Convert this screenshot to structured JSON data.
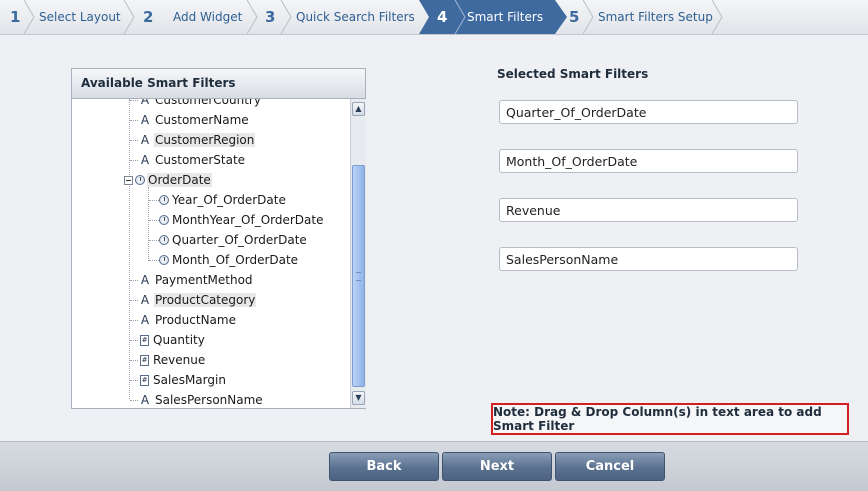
{
  "steps": [
    {
      "num": "1",
      "label": "Select Layout"
    },
    {
      "num": "2",
      "label": "Add Widget"
    },
    {
      "num": "3",
      "label": "Quick Search Filters"
    },
    {
      "num": "4",
      "label": "Smart Filters",
      "active": true
    },
    {
      "num": "5",
      "label": "Smart Filters Setup"
    }
  ],
  "available": {
    "title": "Available Smart Filters",
    "items": [
      {
        "label": "CustomerCountry",
        "icon": "text-a-icon"
      },
      {
        "label": "CustomerName",
        "icon": "text-a-icon"
      },
      {
        "label": "CustomerRegion",
        "icon": "text-a-icon"
      },
      {
        "label": "CustomerState",
        "icon": "text-a-icon"
      },
      {
        "label": "OrderDate",
        "icon": "clock-icon"
      },
      {
        "label": "Year_Of_OrderDate",
        "icon": "clock-icon"
      },
      {
        "label": "MonthYear_Of_OrderDate",
        "icon": "clock-icon"
      },
      {
        "label": "Quarter_Of_OrderDate",
        "icon": "clock-icon"
      },
      {
        "label": "Month_Of_OrderDate",
        "icon": "clock-icon"
      },
      {
        "label": "PaymentMethod",
        "icon": "text-a-icon"
      },
      {
        "label": "ProductCategory",
        "icon": "text-a-icon"
      },
      {
        "label": "ProductName",
        "icon": "text-a-icon"
      },
      {
        "label": "Quantity",
        "icon": "number-icon"
      },
      {
        "label": "Revenue",
        "icon": "number-icon"
      },
      {
        "label": "SalesMargin",
        "icon": "number-icon"
      },
      {
        "label": "SalesPersonName",
        "icon": "text-a-icon"
      }
    ]
  },
  "selected": {
    "title": "Selected Smart Filters",
    "filters": [
      "Quarter_Of_OrderDate",
      "Month_Of_OrderDate",
      "Revenue",
      "SalesPersonName"
    ]
  },
  "note": "Note: Drag & Drop Column(s) in text area to add Smart Filter",
  "buttons": {
    "back": "Back",
    "next": "Next",
    "cancel": "Cancel"
  },
  "icons": {
    "text": "A",
    "number": "#",
    "scroll_up": "▲",
    "scroll_down": "▼"
  },
  "colors": {
    "accent": "#3f6aa0",
    "note_border": "#d21f1f"
  }
}
